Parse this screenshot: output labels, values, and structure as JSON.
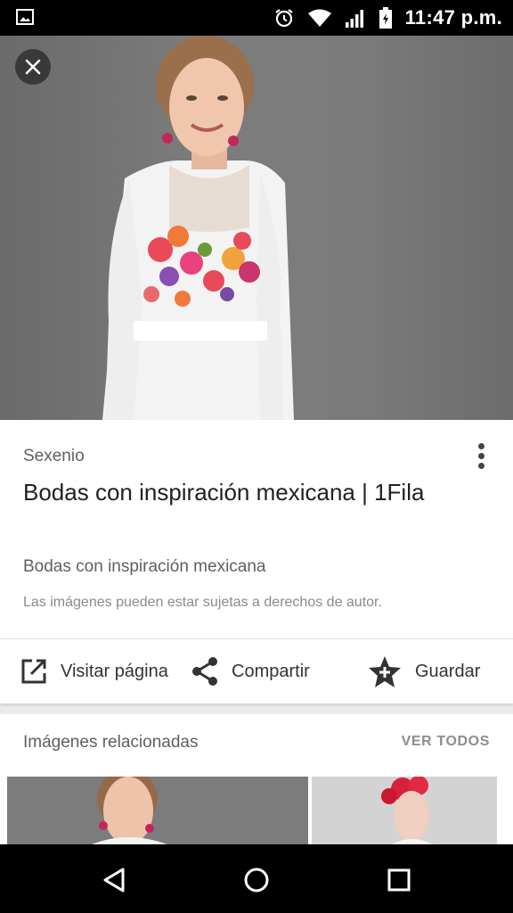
{
  "status_bar": {
    "time": "11:47 p.m."
  },
  "detail": {
    "source": "Sexenio",
    "title": "Bodas con inspiración mexicana | 1Fila",
    "subtitle": "Bodas con inspiración mexicana",
    "copyright": "Las imágenes pueden estar sujetas a derechos de autor."
  },
  "actions": {
    "visit": "Visitar página",
    "share": "Compartir",
    "save": "Guardar"
  },
  "related": {
    "title": "Imágenes relacionadas",
    "see_all": "VER TODOS"
  },
  "colors": {
    "status_bar": "#000000",
    "background": "#ebebeb",
    "text_primary": "#212121",
    "text_secondary": "#5f5f5f"
  },
  "icons": [
    "image-notification-icon",
    "alarm-icon",
    "wifi-icon",
    "signal-icon",
    "battery-icon",
    "close-icon",
    "more-vert-icon",
    "open-in-new-icon",
    "share-icon",
    "star-add-icon",
    "back-icon",
    "home-icon",
    "recents-icon"
  ]
}
